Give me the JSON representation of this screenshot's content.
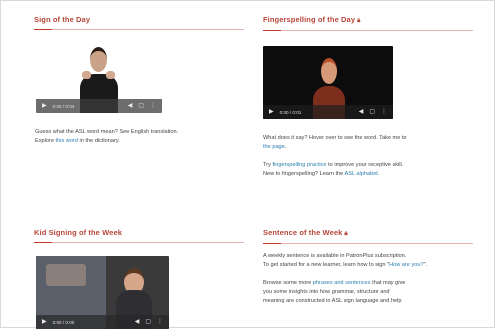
{
  "cards": {
    "sign_of_day": {
      "title": "Sign of the Day",
      "video": {
        "time": "0:00 / 0:04"
      },
      "text_1": "Guess what the ASL word mean? See English translation.",
      "text_2_prefix": "Explore ",
      "text_2_link": "this word",
      "text_2_suffix": " in the dictionary."
    },
    "fingerspelling": {
      "title": "Fingerspelling of the Day",
      "lock_icon": "lock-icon",
      "video": {
        "time": "0:00 / 0:01"
      },
      "text_1": "What does it say? Hover over to see the word. Take me to",
      "text_1_link": "the page",
      "text_1_suffix": ".",
      "text_2_prefix": "Try ",
      "text_2_link": "fingerspelling practice",
      "text_2_suffix": " to improve your receptive skill.",
      "text_3_prefix": "New to fingerspelling? Learn the ",
      "text_3_link": "ASL alphabet",
      "text_3_suffix": "."
    },
    "kid_signing": {
      "title": "Kid Signing of the Week",
      "video": {
        "time": "0:00 / 0:00"
      }
    },
    "sentence_of_week": {
      "title": "Sentence of the Week",
      "lock_icon": "lock-icon",
      "text_1": "A weekly sentence is available in PatronPlus subscription.",
      "text_2_prefix": "To get started for a new learner, learn how to sign \"",
      "text_2_link": "How are you?",
      "text_2_suffix": "\".",
      "text_3_prefix": "Browse some more ",
      "text_3_link": "phrases and sentences",
      "text_3_suffix": " that may give",
      "text_4": "you some insights into how grammar, structure and",
      "text_5": "meaning are constructed in ASL sign language and help"
    }
  },
  "colors": {
    "accent": "#b5473a",
    "link": "#2f7fb0"
  }
}
